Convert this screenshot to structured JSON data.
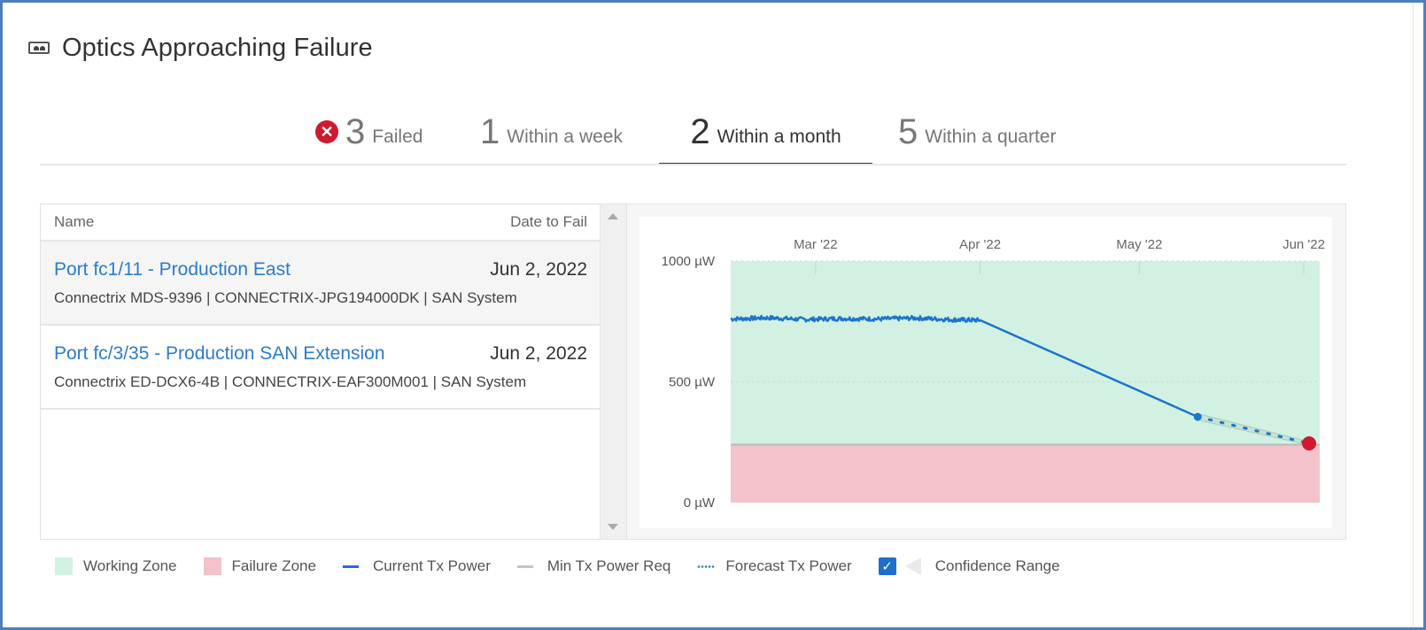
{
  "widget": {
    "title": "Optics Approaching Failure",
    "icon": "optics-transceiver-icon"
  },
  "tabs": [
    {
      "count": "3",
      "label": "Failed",
      "icon": "error-x-icon",
      "active": false
    },
    {
      "count": "1",
      "label": "Within a week",
      "active": false
    },
    {
      "count": "2",
      "label": "Within a month",
      "active": true
    },
    {
      "count": "5",
      "label": "Within a quarter",
      "active": false
    }
  ],
  "table": {
    "columns": {
      "name": "Name",
      "date": "Date to Fail"
    },
    "rows": [
      {
        "name": "Port fc1/11 - Production East",
        "date": "Jun 2, 2022",
        "details": "Connectrix MDS-9396 | CONNECTRIX-JPG194000DK | SAN System",
        "selected": true
      },
      {
        "name": "Port fc/3/35 - Production SAN Extension",
        "date": "Jun 2, 2022",
        "details": "Connectrix ED-DCX6-4B | CONNECTRIX-EAF300M001 | SAN System",
        "selected": false
      }
    ]
  },
  "legend": {
    "working_zone": "Working Zone",
    "failure_zone": "Failure Zone",
    "current_tx": "Current Tx Power",
    "min_tx": "Min Tx Power Req",
    "forecast_tx": "Forecast Tx Power",
    "confidence": "Confidence Range",
    "confidence_checked": true
  },
  "colors": {
    "working_zone": "#d3f1e2",
    "failure_zone": "#f3c2ca",
    "current_line": "#1a74d0",
    "min_line": "#b8bcbc",
    "failure_point": "#d0192e",
    "accent_blue": "#2a7bd1"
  },
  "chart_data": {
    "type": "line",
    "title": "",
    "xlabel": "",
    "ylabel": "",
    "x_tick_labels": [
      "Mar '22",
      "Apr '22",
      "May '22",
      "Jun '22"
    ],
    "x_range": [
      "2022-02-13",
      "2022-06-04"
    ],
    "x_ticks": [
      "2022-03-01",
      "2022-04-01",
      "2022-05-01",
      "2022-06-01"
    ],
    "y_tick_labels": [
      "1000 µW",
      "500 µW",
      "0 µW"
    ],
    "y_ticks": [
      1000,
      500,
      0
    ],
    "ylim": [
      0,
      1000
    ],
    "unit": "µW",
    "min_tx_power_req": 240,
    "series": [
      {
        "name": "Current Tx Power",
        "points": [
          {
            "x": "2022-02-13",
            "y": 760
          },
          {
            "x": "2022-02-20",
            "y": 765
          },
          {
            "x": "2022-02-27",
            "y": 758
          },
          {
            "x": "2022-03-06",
            "y": 762
          },
          {
            "x": "2022-03-13",
            "y": 760
          },
          {
            "x": "2022-03-20",
            "y": 764
          },
          {
            "x": "2022-03-27",
            "y": 757
          },
          {
            "x": "2022-04-01",
            "y": 755
          },
          {
            "x": "2022-05-12",
            "y": 355
          }
        ],
        "noisy_until": "2022-04-01"
      },
      {
        "name": "Forecast Tx Power",
        "points": [
          {
            "x": "2022-05-12",
            "y": 355
          },
          {
            "x": "2022-06-02",
            "y": 245
          }
        ]
      },
      {
        "name": "Confidence Range",
        "upper": [
          {
            "x": "2022-05-12",
            "y": 368
          },
          {
            "x": "2022-06-02",
            "y": 252
          }
        ],
        "lower": [
          {
            "x": "2022-05-12",
            "y": 342
          },
          {
            "x": "2022-06-02",
            "y": 238
          }
        ]
      }
    ],
    "failure_point": {
      "x": "2022-06-02",
      "y": 245
    },
    "grid": true,
    "legend_position": "bottom"
  }
}
